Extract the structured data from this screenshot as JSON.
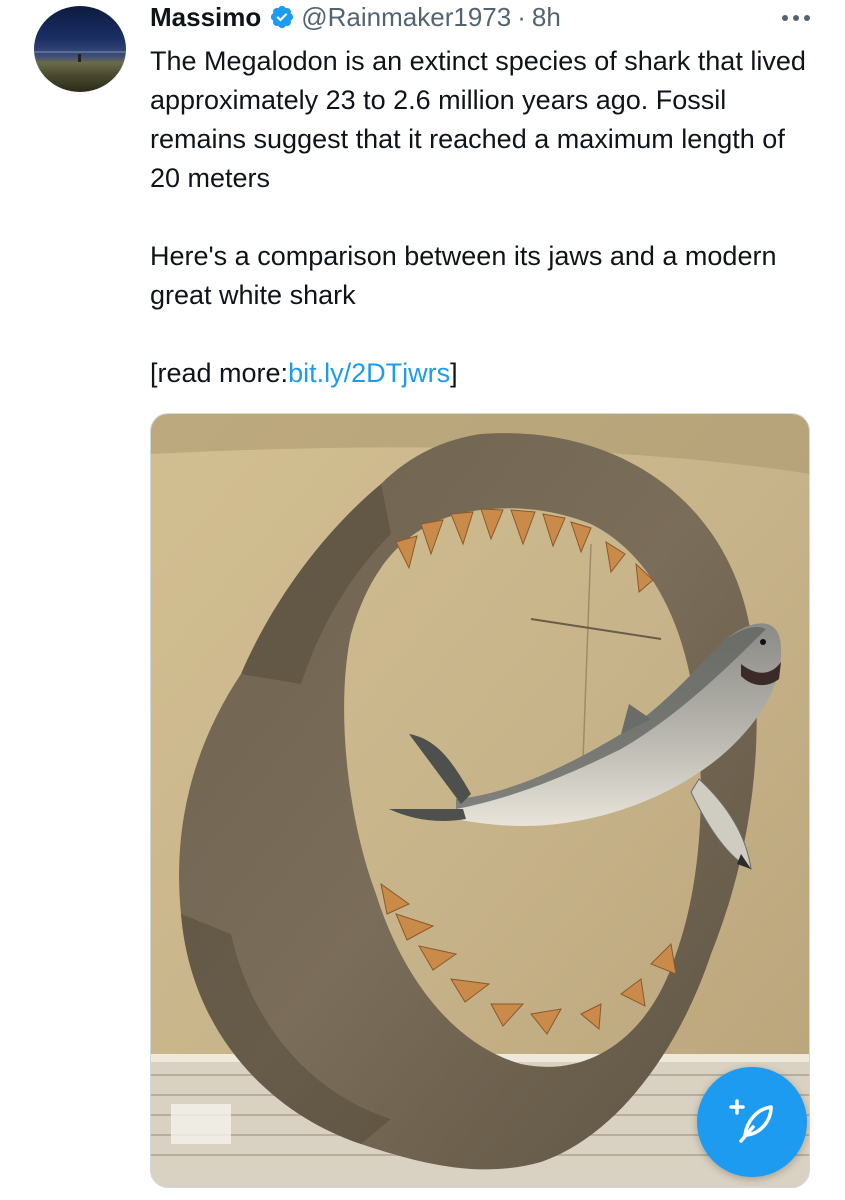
{
  "post": {
    "author_name": "Massimo",
    "handle": "@Rainmaker1973",
    "separator": "·",
    "time": "8h",
    "text_para1": "The Megalodon is an extinct species of shark that lived approximately 23 to 2.6 million years ago. Fossil remains suggest that it reached a maximum length of 20 meters",
    "text_para2": "Here's a comparison between its jaws and a modern great white shark",
    "read_more_prefix": "[read more:",
    "read_more_link": "bit.ly/2DTjwrs",
    "read_more_suffix": "]"
  },
  "icons": {
    "verified": "verified-badge-icon",
    "more": "more-options-icon",
    "compose": "compose-post-icon"
  },
  "colors": {
    "accent": "#1d9bf0",
    "text": "#0f1419",
    "secondary": "#536471"
  }
}
